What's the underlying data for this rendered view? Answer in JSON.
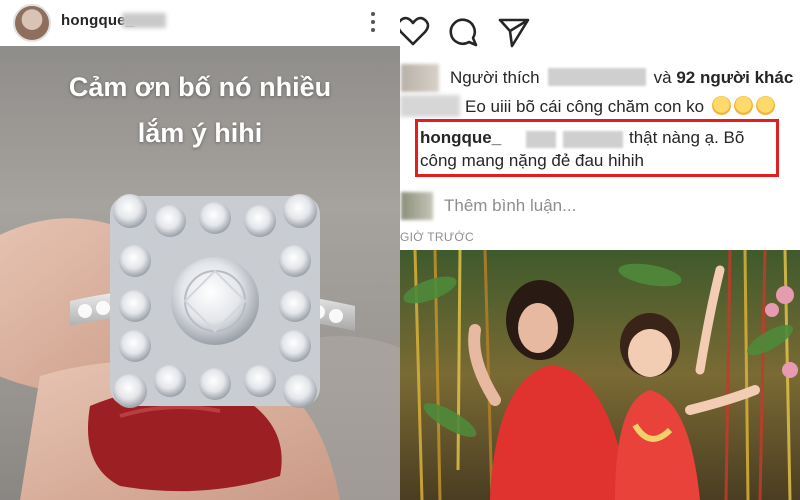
{
  "story": {
    "username": "hongque_",
    "caption_line1": "Cảm ơn bố nó nhiều",
    "caption_line2": "lắm ý hihi"
  },
  "post": {
    "likes": {
      "prefix": "Người thích",
      "conjunction": "và",
      "count": "92 người khác"
    },
    "comment": {
      "text": "Eo uiii bõ cái công chăm con ko"
    },
    "highlighted_reply": {
      "username": "hongque_",
      "text_line1": "thật nàng ạ. Bõ",
      "text_line2": "công mang nặng đẻ đau hihih"
    },
    "add_comment_placeholder": "Thêm bình luận...",
    "timestamp": "GIỜ TRƯỚC"
  },
  "colors": {
    "highlight_border": "#e02020",
    "text": "#262626",
    "muted": "#8e8e8e"
  },
  "icons": [
    "more-vertical-icon",
    "heart-icon",
    "comment-icon",
    "share-icon",
    "smile-emoji-icon"
  ]
}
